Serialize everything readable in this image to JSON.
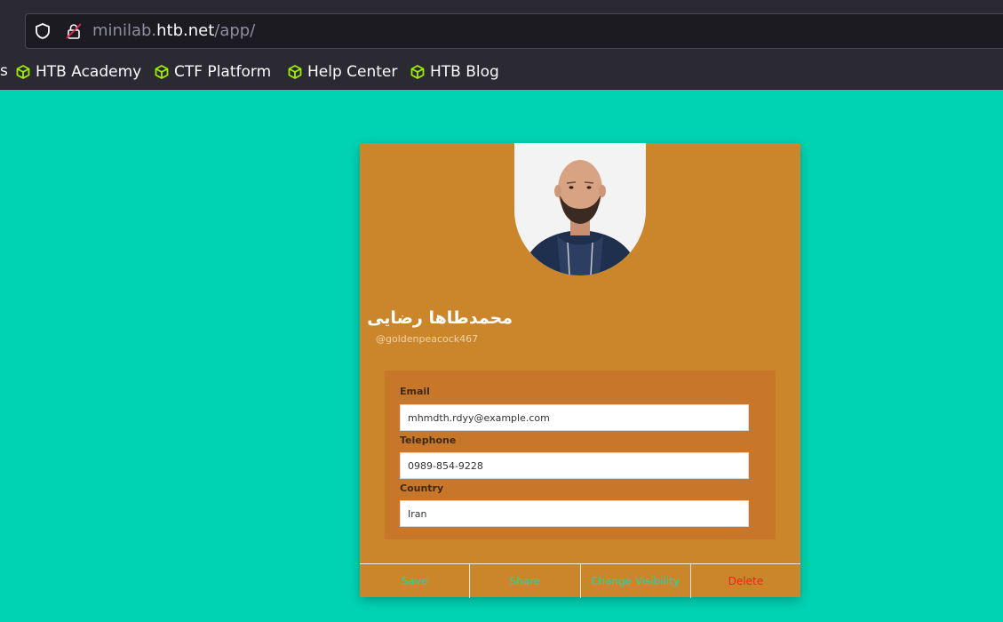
{
  "browser": {
    "url_prefix": "minilab.",
    "url_host": "htb.net",
    "url_path": "/app/",
    "overflow_glyph": "s",
    "bookmarks": [
      {
        "label": "HTB Academy"
      },
      {
        "label": "CTF Platform"
      },
      {
        "label": "Help Center"
      },
      {
        "label": "HTB Blog"
      }
    ],
    "bookmark_icon_color": "#9fef00"
  },
  "profile": {
    "name": "محمدطاها رضایی",
    "handle": "@goldenpeacock467",
    "fields": [
      {
        "label": "Email",
        "value": "mhmdth.rdyy@example.com"
      },
      {
        "label": "Telephone",
        "value": "0989-854-9228"
      },
      {
        "label": "Country",
        "value": "Iran"
      }
    ],
    "actions": {
      "save": "Save",
      "share": "Share",
      "change_visibility": "Change Visibility",
      "delete": "Delete"
    }
  },
  "colors": {
    "page_bg": "#00d3b4",
    "card_bg": "#cb862c",
    "fields_bg": "#c8772a",
    "action_text": "#17d8b6",
    "delete_text": "#ff1a1a"
  }
}
